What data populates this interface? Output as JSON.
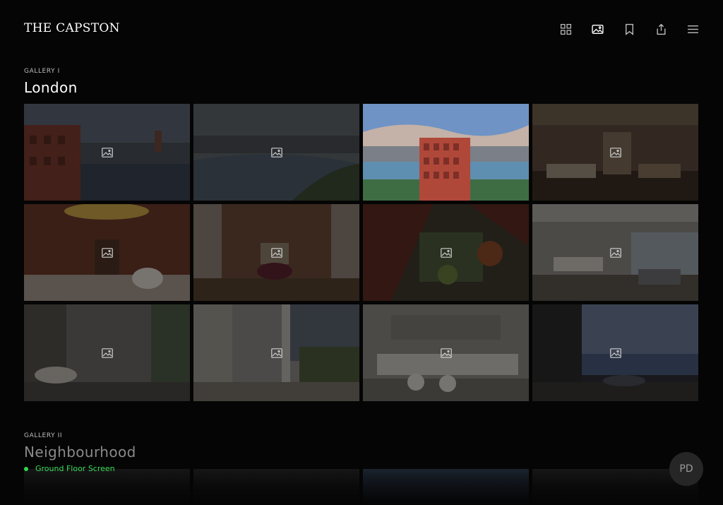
{
  "header": {
    "brand": "THE CAPSTON",
    "actions": [
      {
        "name": "grid-view",
        "icon": "grid-icon"
      },
      {
        "name": "gallery-view",
        "icon": "gallery-icon"
      },
      {
        "name": "bookmark",
        "icon": "bookmark-icon"
      },
      {
        "name": "share",
        "icon": "share-icon"
      },
      {
        "name": "menu",
        "icon": "hamburger-menu-icon"
      }
    ]
  },
  "galleries": [
    {
      "eyebrow": "GALLERY I",
      "title": "London",
      "images": [
        {
          "subject": "aerial river view with brick building",
          "active": false
        },
        {
          "subject": "river at dusk",
          "active": false
        },
        {
          "subject": "brick tower by the river at sunset",
          "active": true
        },
        {
          "subject": "lounge with chandelier",
          "active": false
        },
        {
          "subject": "dining room with painted ceiling",
          "active": false
        },
        {
          "subject": "marble sitting room",
          "active": false
        },
        {
          "subject": "aerial courtyard garden",
          "active": false
        },
        {
          "subject": "open plan living room",
          "active": false
        },
        {
          "subject": "street with vintage car",
          "active": false
        },
        {
          "subject": "colonnade walkway",
          "active": false
        },
        {
          "subject": "white kitchen",
          "active": false
        },
        {
          "subject": "balcony at twilight",
          "active": false
        }
      ]
    },
    {
      "eyebrow": "GALLERY II",
      "title": "Neighbourhood"
    }
  ],
  "status": {
    "label": "Ground Floor Screen",
    "color": "#2fd94c"
  },
  "user": {
    "initials": "PD"
  }
}
